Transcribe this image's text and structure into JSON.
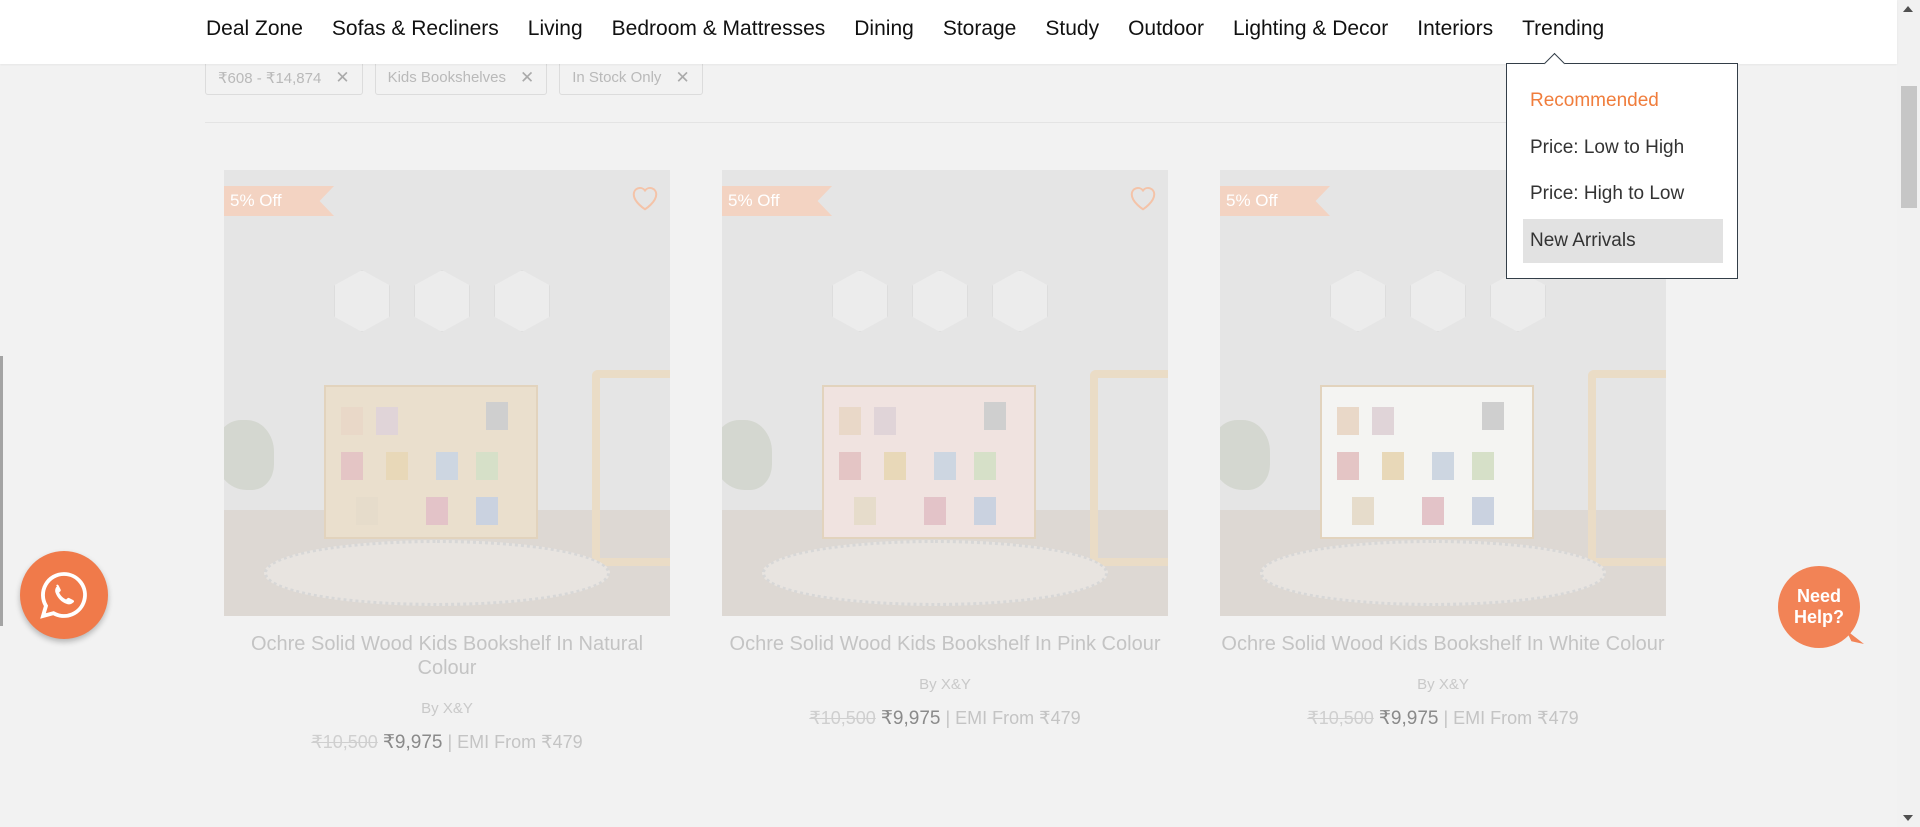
{
  "nav": {
    "items": [
      "Deal Zone",
      "Sofas & Recliners",
      "Living",
      "Bedroom & Mattresses",
      "Dining",
      "Storage",
      "Study",
      "Outdoor",
      "Lighting & Decor",
      "Interiors",
      "Trending"
    ]
  },
  "filters": {
    "chips": [
      {
        "label": "₹608 - ₹14,874",
        "remove": "✕"
      },
      {
        "label": "Kids Bookshelves",
        "remove": "✕"
      },
      {
        "label": "In Stock Only",
        "remove": "✕"
      }
    ]
  },
  "sort": {
    "options": [
      "Recommended",
      "Price: Low to High",
      "Price: High to Low",
      "New Arrivals"
    ],
    "selected": "Recommended",
    "hovered": "New Arrivals"
  },
  "products": [
    {
      "badge": "5% Off",
      "title": "Ochre Solid Wood Kids Bookshelf In Natural Colour",
      "brand": "By X&Y",
      "old_price": "₹10,500",
      "price": "₹9,975",
      "emi": "| EMI From ₹479"
    },
    {
      "badge": "5% Off",
      "title": "Ochre Solid Wood Kids Bookshelf In Pink Colour",
      "brand": "By X&Y",
      "old_price": "₹10,500",
      "price": "₹9,975",
      "emi": "| EMI From ₹479"
    },
    {
      "badge": "5% Off",
      "title": "Ochre Solid Wood Kids Bookshelf In White Colour",
      "brand": "By X&Y",
      "old_price": "₹10,500",
      "price": "₹9,975",
      "emi": "| EMI From ₹479"
    }
  ],
  "help": {
    "label_line1": "Need",
    "label_line2": "Help?"
  },
  "colors": {
    "accent": "#f07d3c",
    "badge": "#f3d3c2"
  }
}
